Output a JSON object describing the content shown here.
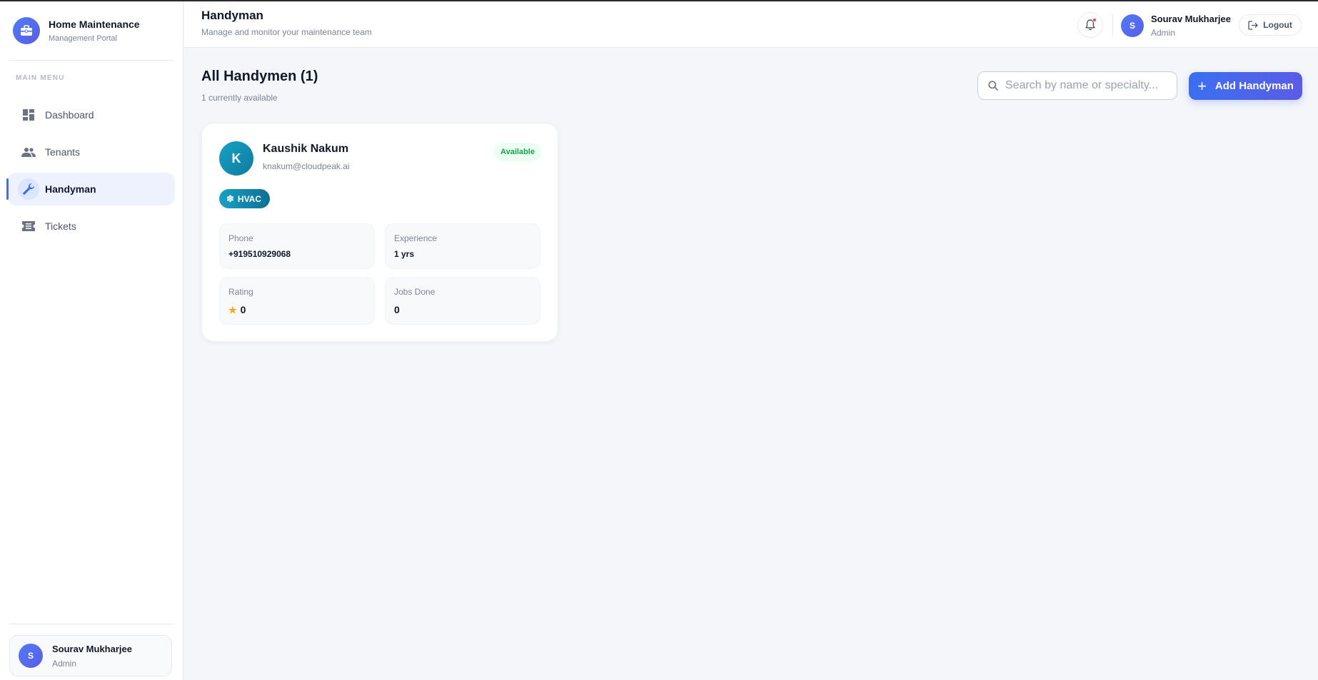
{
  "brand": {
    "title": "Home Maintenance",
    "subtitle": "Management Portal"
  },
  "sidebar": {
    "heading": "MAIN MENU",
    "items": [
      {
        "label": "Dashboard",
        "icon": "dashboard-icon"
      },
      {
        "label": "Tenants",
        "icon": "people-icon"
      },
      {
        "label": "Handyman",
        "icon": "wrench-icon",
        "active": true
      },
      {
        "label": "Tickets",
        "icon": "ticket-icon"
      }
    ],
    "user": {
      "initial": "S",
      "name": "Sourav Mukharjee",
      "role": "Admin"
    }
  },
  "header": {
    "title": "Handyman",
    "subtitle": "Manage and monitor your maintenance team",
    "user": {
      "initial": "S",
      "name": "Sourav Mukharjee",
      "role": "Admin"
    },
    "logout_label": "Logout"
  },
  "main": {
    "heading": "All Handymen (1)",
    "availability": "1 currently available",
    "search": {
      "placeholder": "Search by name or specialty...",
      "value": ""
    },
    "add_label": "Add Handyman"
  },
  "handymen": [
    {
      "initial": "K",
      "name": "Kaushik Nakum",
      "email": "knakum@cloudpeak.ai",
      "status": "Available",
      "specialty": "HVAC",
      "phone_label": "Phone",
      "phone": "+919510929068",
      "experience_label": "Experience",
      "experience": "1 yrs",
      "rating_label": "Rating",
      "rating": "0",
      "jobs_label": "Jobs Done",
      "jobs": "0"
    }
  ],
  "colors": {
    "accent": "#3b6ff0",
    "accent_end": "#5b5ce6",
    "specialty_teal": "#17a2c4",
    "available_green": "#16a34a",
    "notification_red": "#ef4444",
    "star_gold": "#f5a623"
  }
}
